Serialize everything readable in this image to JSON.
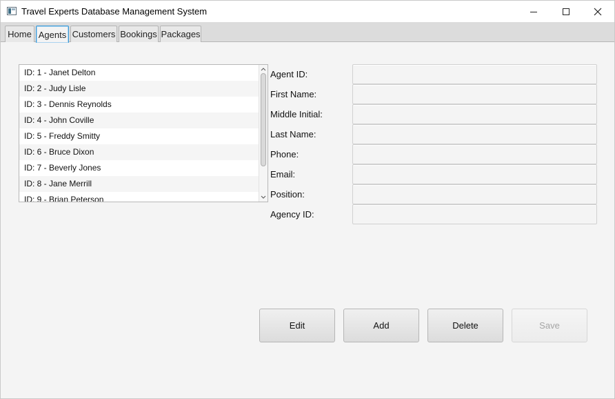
{
  "window": {
    "title": "Travel Experts Database Management System"
  },
  "tabs": [
    {
      "label": "Home"
    },
    {
      "label": "Agents"
    },
    {
      "label": "Customers"
    },
    {
      "label": "Bookings"
    },
    {
      "label": "Packages"
    }
  ],
  "active_tab": "Agents",
  "agents_list": {
    "items": [
      "ID: 1 - Janet Delton",
      "ID: 2 - Judy Lisle",
      "ID: 3 - Dennis Reynolds",
      "ID: 4 - John Coville",
      "ID: 5 - Freddy Smitty",
      "ID: 6 - Bruce Dixon",
      "ID: 7 - Beverly Jones",
      "ID: 8 - Jane Merrill",
      "ID: 9 - Brian Peterson"
    ]
  },
  "form": {
    "fields": [
      {
        "label": "Agent ID:",
        "value": ""
      },
      {
        "label": "First Name:",
        "value": ""
      },
      {
        "label": "Middle Initial:",
        "value": ""
      },
      {
        "label": "Last Name:",
        "value": ""
      },
      {
        "label": "Phone:",
        "value": ""
      },
      {
        "label": "Email:",
        "value": ""
      },
      {
        "label": "Position:",
        "value": ""
      },
      {
        "label": "Agency ID:",
        "value": ""
      }
    ]
  },
  "actions": {
    "edit_label": "Edit",
    "add_label": "Add",
    "delete_label": "Delete",
    "save_label": "Save",
    "save_enabled": false
  },
  "icons": {
    "app": "app-window-icon",
    "minimize": "minimize-icon",
    "maximize": "maximize-icon",
    "close": "close-icon",
    "scroll_up": "chevron-up-icon",
    "scroll_down": "chevron-down-icon"
  },
  "colors": {
    "tab_accent": "#3d9ad6",
    "background": "#f4f4f4",
    "disabled_text": "#a5a5a5"
  }
}
